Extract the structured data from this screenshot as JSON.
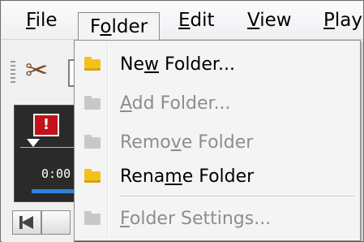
{
  "menubar": {
    "items": [
      {
        "label": "File",
        "mnemonic": 0
      },
      {
        "label": "Folder",
        "mnemonic": 1
      },
      {
        "label": "Edit",
        "mnemonic": 0
      },
      {
        "label": "View",
        "mnemonic": 0
      },
      {
        "label": "Play",
        "mnemonic": 0
      }
    ],
    "active": "Folder"
  },
  "player": {
    "time": "0:00",
    "progress_fraction": 0.0
  },
  "dropdown": {
    "items": [
      {
        "label": "New Folder...",
        "mnemonic": 2,
        "enabled": true,
        "icon": "folder-new-icon",
        "icon_color": "#f2c21a"
      },
      {
        "label": "Add Folder...",
        "mnemonic": 0,
        "enabled": false,
        "icon": "folder-add-icon",
        "icon_color": "#c8c8c8"
      },
      {
        "label": "Remove Folder",
        "mnemonic": 4,
        "enabled": false,
        "icon": "folder-remove-icon",
        "icon_color": "#c8c8c8"
      },
      {
        "label": "Rename Folder",
        "mnemonic": 4,
        "enabled": true,
        "icon": "folder-rename-icon",
        "icon_color": "#f2c21a"
      },
      {
        "label": "Folder Settings...",
        "mnemonic": 0,
        "enabled": false,
        "icon": "folder-settings-icon",
        "icon_color": "#c8c8c8"
      }
    ]
  },
  "colors": {
    "accent": "#2e84d6",
    "warning": "#c3121a",
    "disabled_text": "#8d8d8d"
  }
}
